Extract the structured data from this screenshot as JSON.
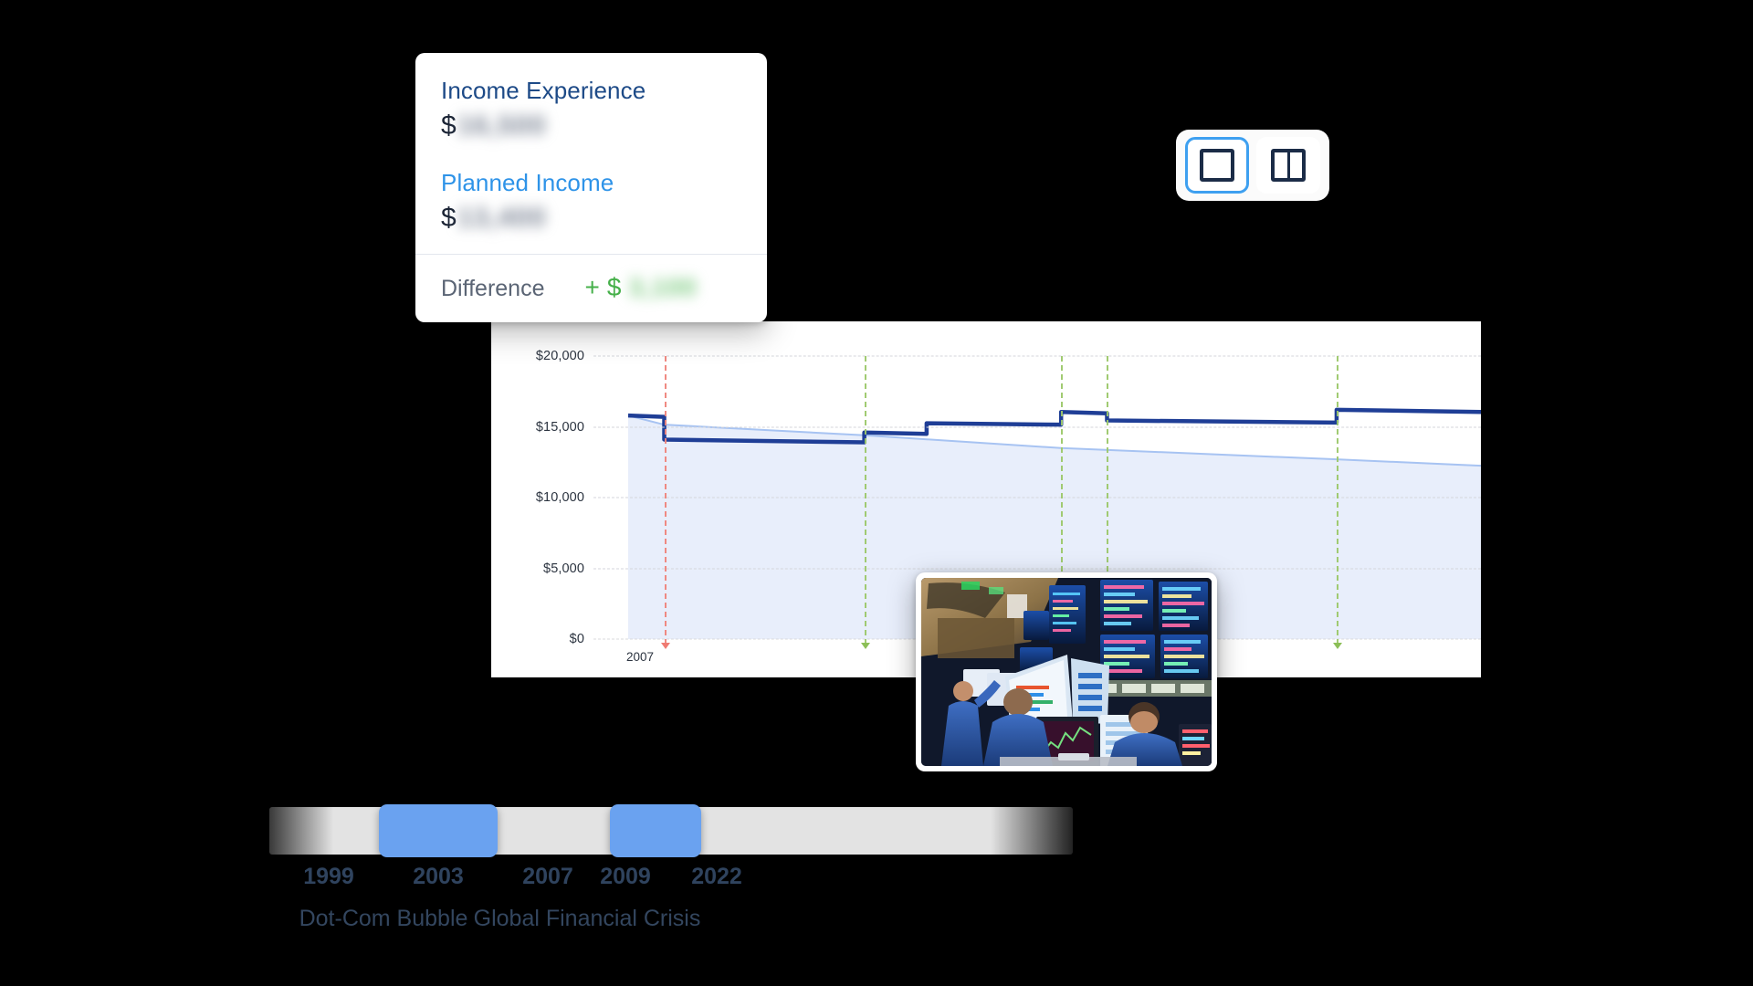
{
  "tooltip": {
    "income_experience_label": "Income Experience",
    "income_experience_currency": "$",
    "income_experience_value": "16,500",
    "planned_income_label": "Planned Income",
    "planned_income_currency": "$",
    "planned_income_value": "13,400",
    "difference_label": "Difference",
    "difference_sign": "+",
    "difference_currency": "$",
    "difference_value": "3,100",
    "colors": {
      "income_experience": "#1d4a87",
      "planned_income": "#2e93e8",
      "difference_positive": "#46b04a"
    }
  },
  "view_toggle": {
    "single_view_icon": "single-pane-icon",
    "split_view_icon": "split-pane-icon",
    "selected": "single",
    "accent": "#3ea0f0"
  },
  "photo": {
    "name": "stock-exchange-trading-floor-photo",
    "alt": "Traders in blue jackets at a stock exchange trading floor surrounded by monitors"
  },
  "timeline": {
    "years": [
      "1999",
      "2003",
      "2007",
      "2009",
      "2022"
    ],
    "events": [
      {
        "label": "Dot-Com Bubble",
        "start_year": "1999",
        "end_year": "2003"
      },
      {
        "label": "Global Financial Crisis",
        "start_year": "2007",
        "end_year": "2009"
      }
    ],
    "selected_ranges": [
      {
        "label": "Dot-Com Bubble",
        "left_pct": 13.6,
        "width_pct": 14.8
      },
      {
        "label": "Global Financial Crisis",
        "left_pct": 42.4,
        "width_pct": 11.3
      }
    ],
    "track_color": "#e3e3e3",
    "handle_color": "#6aa2f0"
  },
  "chart_data": {
    "type": "line",
    "title": "",
    "xlabel": "",
    "ylabel": "",
    "ylim": [
      0,
      20000
    ],
    "yticks": [
      0,
      5000,
      10000,
      15000,
      20000
    ],
    "ytick_labels": [
      "$0",
      "$5,000",
      "$10,000",
      "$15,000",
      "$20,000"
    ],
    "xticks": [
      "2007"
    ],
    "xtick_labels": [
      "2007"
    ],
    "grid": true,
    "legend_position": "none",
    "series": [
      {
        "name": "Income Experience",
        "color": "#1f3e96",
        "style": "step",
        "x": [
          2007.0,
          2007.55,
          2007.55,
          2010.6,
          2010.6,
          2011.55,
          2011.55,
          2013.6,
          2013.6,
          2014.3,
          2014.3,
          2017.8,
          2017.8,
          2020.0
        ],
        "values": [
          15800,
          15700,
          14100,
          13900,
          14600,
          14500,
          15250,
          15150,
          16050,
          15950,
          15450,
          15300,
          16200,
          16050
        ]
      },
      {
        "name": "Planned Income",
        "color": "#a7c3f2",
        "style": "line",
        "fill": "#e8eefb",
        "x": [
          2007.0,
          2007.55,
          2010.6,
          2013.6,
          2017.8,
          2020.0
        ],
        "values": [
          15800,
          15150,
          14400,
          13500,
          12700,
          12250
        ]
      }
    ],
    "annotations": [
      {
        "type": "vline",
        "label": "2007",
        "x": 2007.55,
        "color": "#f0847c",
        "style": "dashed"
      },
      {
        "type": "vline",
        "label": "event-marker-1",
        "x": 2010.6,
        "color": "#9dc96b",
        "style": "dashed"
      },
      {
        "type": "vline",
        "label": "event-marker-2",
        "x": 2013.6,
        "color": "#9dc96b",
        "style": "dashed"
      },
      {
        "type": "vline",
        "label": "event-marker-3",
        "x": 2014.3,
        "color": "#9dc96b",
        "style": "dashed"
      },
      {
        "type": "vline",
        "label": "event-marker-4",
        "x": 2017.8,
        "color": "#9dc96b",
        "style": "dashed"
      }
    ]
  }
}
